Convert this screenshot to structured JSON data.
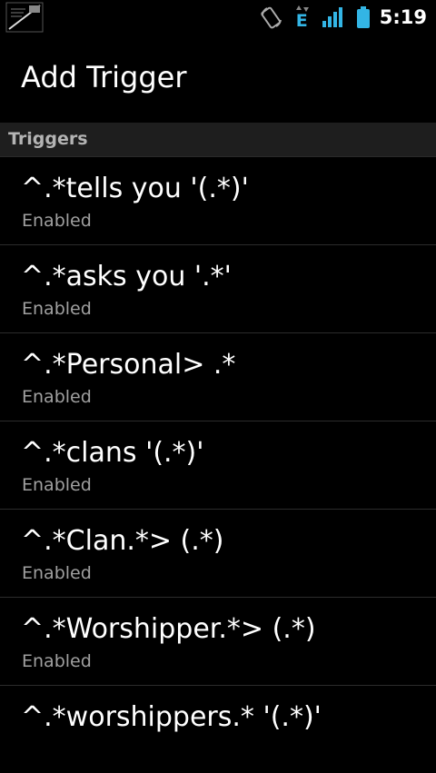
{
  "status_bar": {
    "time": "5:19",
    "network_type": "E",
    "icons": [
      "notification-app-icon",
      "rotate-icon",
      "data-activity-icon",
      "signal-strength-icon",
      "battery-icon"
    ]
  },
  "header": {
    "title": "Add Trigger"
  },
  "section": {
    "label": "Triggers"
  },
  "triggers": [
    {
      "pattern": "^.*tells you '(.*)'",
      "status": "Enabled"
    },
    {
      "pattern": "^.*asks you '.*'",
      "status": "Enabled"
    },
    {
      "pattern": "^.*Personal> .*",
      "status": "Enabled"
    },
    {
      "pattern": "^.*clans '(.*)'",
      "status": "Enabled"
    },
    {
      "pattern": "^.*Clan.*> (.*)",
      "status": "Enabled"
    },
    {
      "pattern": "^.*Worshipper.*> (.*)",
      "status": "Enabled"
    },
    {
      "pattern": "^.*worshippers.* '(.*)'",
      "status": ""
    }
  ],
  "colors": {
    "background": "#000000",
    "section_header_bg": "#1e1e1e",
    "section_header_text": "#b4b4b4",
    "primary_text": "#ffffff",
    "secondary_text": "#a0a0a0",
    "status_accent": "#33b5e5"
  }
}
